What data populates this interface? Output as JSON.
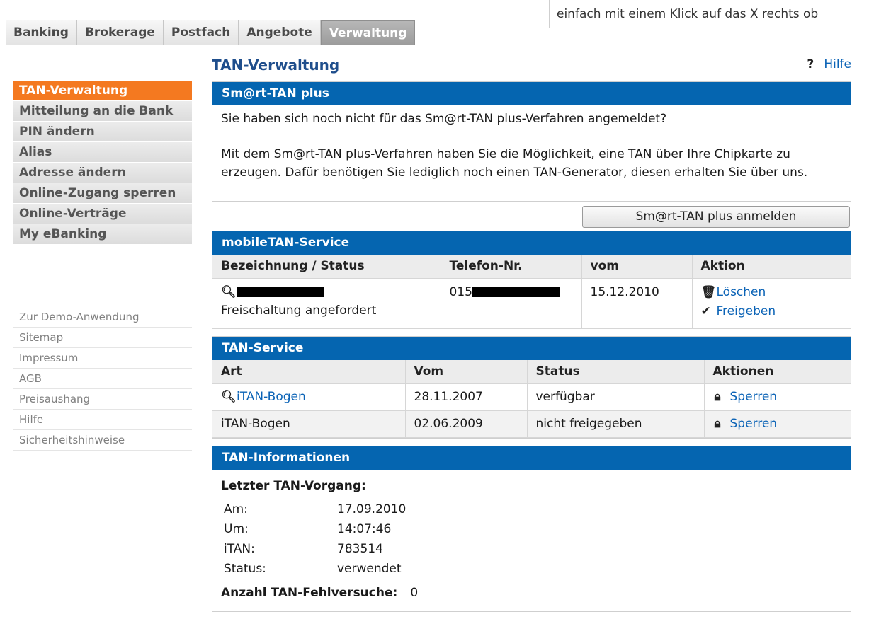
{
  "top": {
    "tabs": [
      "Banking",
      "Brokerage",
      "Postfach",
      "Angebote",
      "Verwaltung"
    ],
    "active_tab": "Verwaltung",
    "hint": "einfach mit einem Klick auf das X rechts ob"
  },
  "sidebar": {
    "items": [
      {
        "label": "TAN-Verwaltung",
        "active": true
      },
      {
        "label": "Mitteilung an die Bank"
      },
      {
        "label": "PIN ändern"
      },
      {
        "label": "Alias"
      },
      {
        "label": "Adresse ändern"
      },
      {
        "label": "Online-Zugang sperren"
      },
      {
        "label": "Online-Verträge"
      },
      {
        "label": "My eBanking"
      }
    ],
    "links": [
      "Zur Demo-Anwendung",
      "Sitemap",
      "Impressum",
      "AGB",
      "Preisaushang",
      "Hilfe",
      "Sicherheitshinweise"
    ]
  },
  "main": {
    "title": "TAN-Verwaltung",
    "help": "Hilfe",
    "smarttan": {
      "head": "Sm@rt-TAN plus",
      "line1": "Sie haben sich noch nicht für das Sm@rt-TAN plus-Verfahren angemeldet?",
      "line2": "Mit dem Sm@rt-TAN plus-Verfahren haben Sie die Möglichkeit, eine TAN über Ihre Chipkarte zu erzeugen. Dafür benötigen Sie lediglich noch einen TAN-Generator, diesen erhalten Sie über uns.",
      "button": "Sm@rt-TAN plus anmelden"
    },
    "mobiletan": {
      "head": "mobileTAN-Service",
      "columns": [
        "Bezeichnung / Status",
        "Telefon-Nr.",
        "vom",
        "Aktion"
      ],
      "row": {
        "status": "Freischaltung angefordert",
        "phone_prefix": "015",
        "date": "15.12.2010",
        "action_delete": "Löschen",
        "action_release": "Freigeben"
      }
    },
    "tanservice": {
      "head": "TAN-Service",
      "columns": [
        "Art",
        "Vom",
        "Status",
        "Aktionen"
      ],
      "rows": [
        {
          "art": "iTAN-Bogen",
          "vom": "28.11.2007",
          "status": "verfügbar",
          "aktion": "Sperren"
        },
        {
          "art": "iTAN-Bogen",
          "vom": "02.06.2009",
          "status": "nicht freigegeben",
          "aktion": "Sperren"
        }
      ]
    },
    "taninfo": {
      "head": "TAN-Informationen",
      "subtitle": "Letzter TAN-Vorgang:",
      "am_label": "Am:",
      "am": "17.09.2010",
      "um_label": "Um:",
      "um": "14:07:46",
      "itan_label": "iTAN:",
      "itan": "783514",
      "status_label": "Status:",
      "status": "verwendet",
      "fail_label": "Anzahl TAN-Fehlversuche:",
      "fail": "0"
    }
  }
}
